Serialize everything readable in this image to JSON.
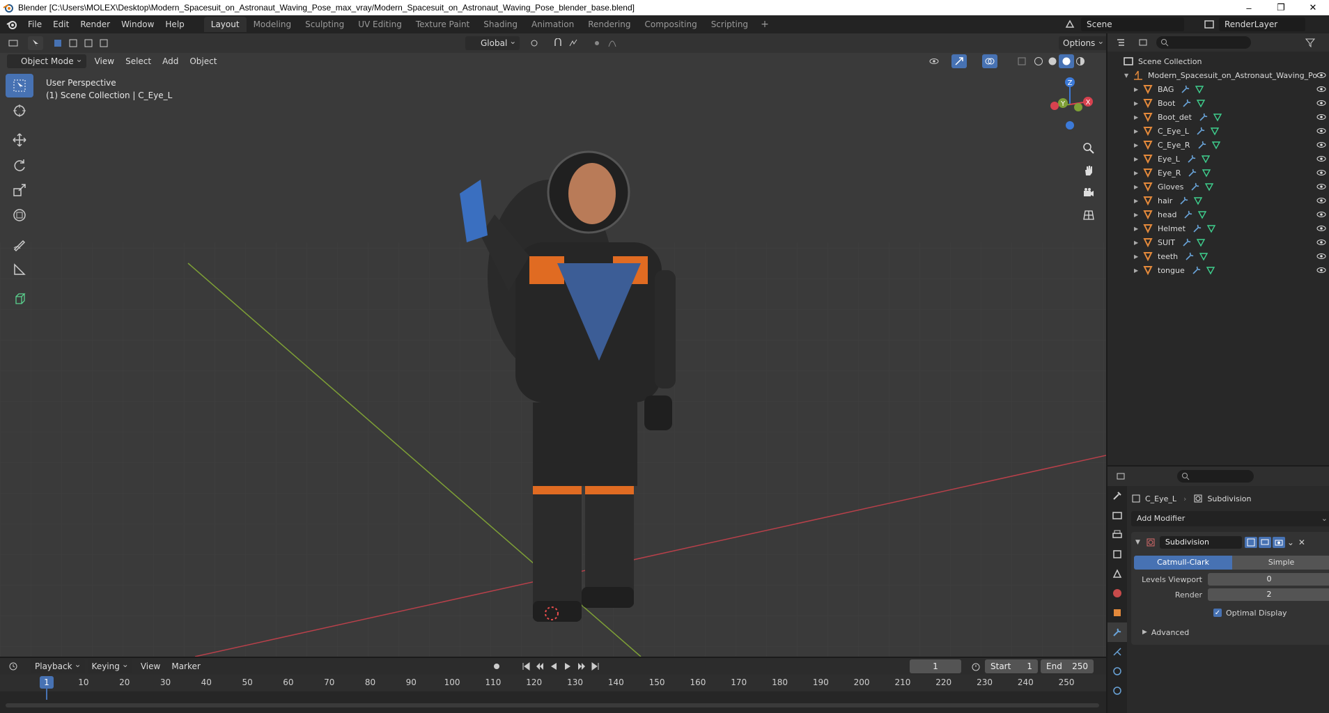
{
  "window": {
    "title": "Blender [C:\\Users\\MOLEX\\Desktop\\Modern_Spacesuit_on_Astronaut_Waving_Pose_max_vray/Modern_Spacesuit_on_Astronaut_Waving_Pose_blender_base.blend]",
    "minimize": "–",
    "maximize": "❐",
    "close": "✕"
  },
  "menu": [
    "File",
    "Edit",
    "Render",
    "Window",
    "Help"
  ],
  "workspaces": [
    "Layout",
    "Modeling",
    "Sculpting",
    "UV Editing",
    "Texture Paint",
    "Shading",
    "Animation",
    "Rendering",
    "Compositing",
    "Scripting"
  ],
  "workspace_add": "+",
  "scene": {
    "name": "Scene",
    "render_layer": "RenderLayer"
  },
  "viewport": {
    "transform_orientation": "Global",
    "options": "Options",
    "mode": "Object Mode",
    "menus": [
      "View",
      "Select",
      "Add",
      "Object"
    ],
    "info_line1": "User Perspective",
    "info_line2": "(1) Scene Collection | C_Eye_L",
    "gizmo": {
      "x": "X",
      "y": "Y",
      "z": "Z"
    }
  },
  "outliner": {
    "root": "Scene Collection",
    "collection": "Modern_Spacesuit_on_Astronaut_Waving_Po",
    "objects": [
      "BAG",
      "Boot",
      "Boot_det",
      "C_Eye_L",
      "C_Eye_R",
      "Eye_L",
      "Eye_R",
      "Gloves",
      "hair",
      "head",
      "Helmet",
      "SUIT",
      "teeth",
      "tongue"
    ]
  },
  "properties": {
    "object": "C_Eye_L",
    "modifier_type": "Subdivision",
    "add_modifier": "Add Modifier",
    "modifier_name": "Subdivision",
    "method_a": "Catmull-Clark",
    "method_b": "Simple",
    "levels_viewport_label": "Levels Viewport",
    "levels_viewport": "0",
    "render_label": "Render",
    "render": "2",
    "optimal_display": "Optimal Display",
    "advanced": "Advanced"
  },
  "timeline": {
    "menus": [
      "Playback",
      "Keying",
      "View",
      "Marker"
    ],
    "current_frame": "1",
    "start_label": "Start",
    "start": "1",
    "end_label": "End",
    "end": "250",
    "ticks": [
      "1",
      "10",
      "20",
      "30",
      "40",
      "50",
      "60",
      "70",
      "80",
      "90",
      "100",
      "110",
      "120",
      "130",
      "140",
      "150",
      "160",
      "170",
      "180",
      "190",
      "200",
      "210",
      "220",
      "230",
      "240",
      "250"
    ]
  },
  "colors": {
    "accent": "#4772b3",
    "mesh_icon": "#e3893b",
    "modifier_icon": "#6aa4d9",
    "vertex_icon": "#3fcf8e"
  }
}
